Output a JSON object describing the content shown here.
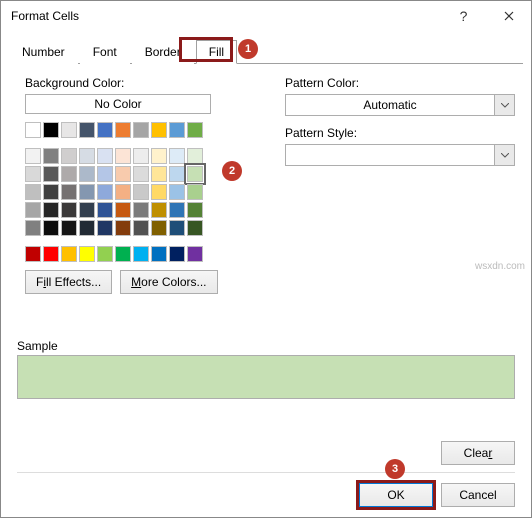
{
  "title": "Format Cells",
  "tabs": [
    "Number",
    "Font",
    "Border",
    "Fill"
  ],
  "active_tab_index": 3,
  "annotations": {
    "tab": "1",
    "swatch": "2",
    "ok": "3"
  },
  "left": {
    "bg_label": "Background Color:",
    "no_color": "No Color",
    "row1": [
      "#ffffff",
      "#000000",
      "#e7e6e6",
      "#44546a",
      "#4472c4",
      "#ed7d31",
      "#a5a5a5",
      "#ffc000",
      "#5b9bd5",
      "#70ad47"
    ],
    "theme": [
      [
        "#f2f2f2",
        "#808080",
        "#d0cece",
        "#d6dce4",
        "#d9e1f2",
        "#fce4d6",
        "#ededed",
        "#fff2cc",
        "#ddebf7",
        "#e2efda"
      ],
      [
        "#d9d9d9",
        "#595959",
        "#aeaaaa",
        "#acb9ca",
        "#b4c6e7",
        "#f8cbad",
        "#dbdbdb",
        "#ffe699",
        "#bdd7ee",
        "#c6e0b4"
      ],
      [
        "#bfbfbf",
        "#404040",
        "#757171",
        "#8497b0",
        "#8ea9db",
        "#f4b084",
        "#c9c9c9",
        "#ffd966",
        "#9bc2e6",
        "#a9d08e"
      ],
      [
        "#a6a6a6",
        "#262626",
        "#3a3838",
        "#333f4f",
        "#305496",
        "#c65911",
        "#7b7b7b",
        "#bf8f00",
        "#2f75b5",
        "#548235"
      ],
      [
        "#808080",
        "#0d0d0d",
        "#161616",
        "#222b35",
        "#203764",
        "#833c0c",
        "#525252",
        "#806000",
        "#1f4e78",
        "#375623"
      ]
    ],
    "standard": [
      "#c00000",
      "#ff0000",
      "#ffc000",
      "#ffff00",
      "#92d050",
      "#00b050",
      "#00b0f0",
      "#0070c0",
      "#002060",
      "#7030a0"
    ],
    "selected": {
      "row": 1,
      "col": 9
    },
    "fill_effects": {
      "pre": "F",
      "u": "i",
      "post": "ll Effects..."
    },
    "more_colors": {
      "pre": "",
      "u": "M",
      "post": "ore Colors..."
    }
  },
  "right": {
    "pattern_color_label": "Pattern Color:",
    "pattern_color_value": "Automatic",
    "pattern_style_label": "Pattern Style:"
  },
  "sample": {
    "label": "Sample",
    "color": "#c6e0b4"
  },
  "clear": {
    "pre": "Clea",
    "u": "r",
    "post": ""
  },
  "ok": "OK",
  "cancel": "Cancel",
  "watermark": "wsxdn.com"
}
